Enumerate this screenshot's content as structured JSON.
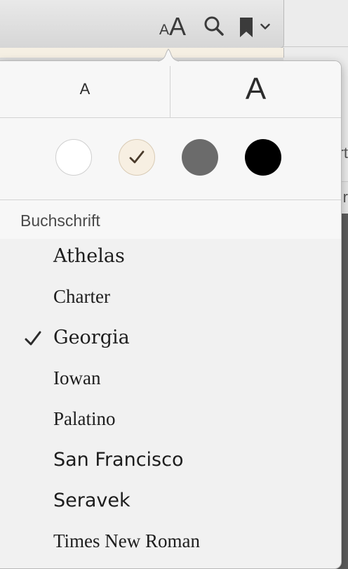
{
  "toolbar": {
    "font_size_small_glyph": "A",
    "font_size_large_glyph": "A",
    "icons": [
      "font-size-icon",
      "search-icon",
      "bookmark-icon",
      "chevron-down-icon"
    ]
  },
  "background": {
    "peek1": "rt",
    "peek2": "r"
  },
  "popover": {
    "size_small_label": "A",
    "size_large_label": "A",
    "themes": [
      {
        "name": "white",
        "color": "#ffffff",
        "selected": false
      },
      {
        "name": "sepia",
        "color": "#f7efe2",
        "selected": true
      },
      {
        "name": "gray",
        "color": "#6b6b6b",
        "selected": false
      },
      {
        "name": "black",
        "color": "#000000",
        "selected": false
      }
    ],
    "font_section_title": "Buchschrift",
    "fonts": [
      {
        "label": "Athelas",
        "selected": false
      },
      {
        "label": "Charter",
        "selected": false
      },
      {
        "label": "Georgia",
        "selected": true
      },
      {
        "label": "Iowan",
        "selected": false
      },
      {
        "label": "Palatino",
        "selected": false
      },
      {
        "label": "San Francisco",
        "selected": false
      },
      {
        "label": "Seravek",
        "selected": false
      },
      {
        "label": "Times New Roman",
        "selected": false
      }
    ]
  }
}
